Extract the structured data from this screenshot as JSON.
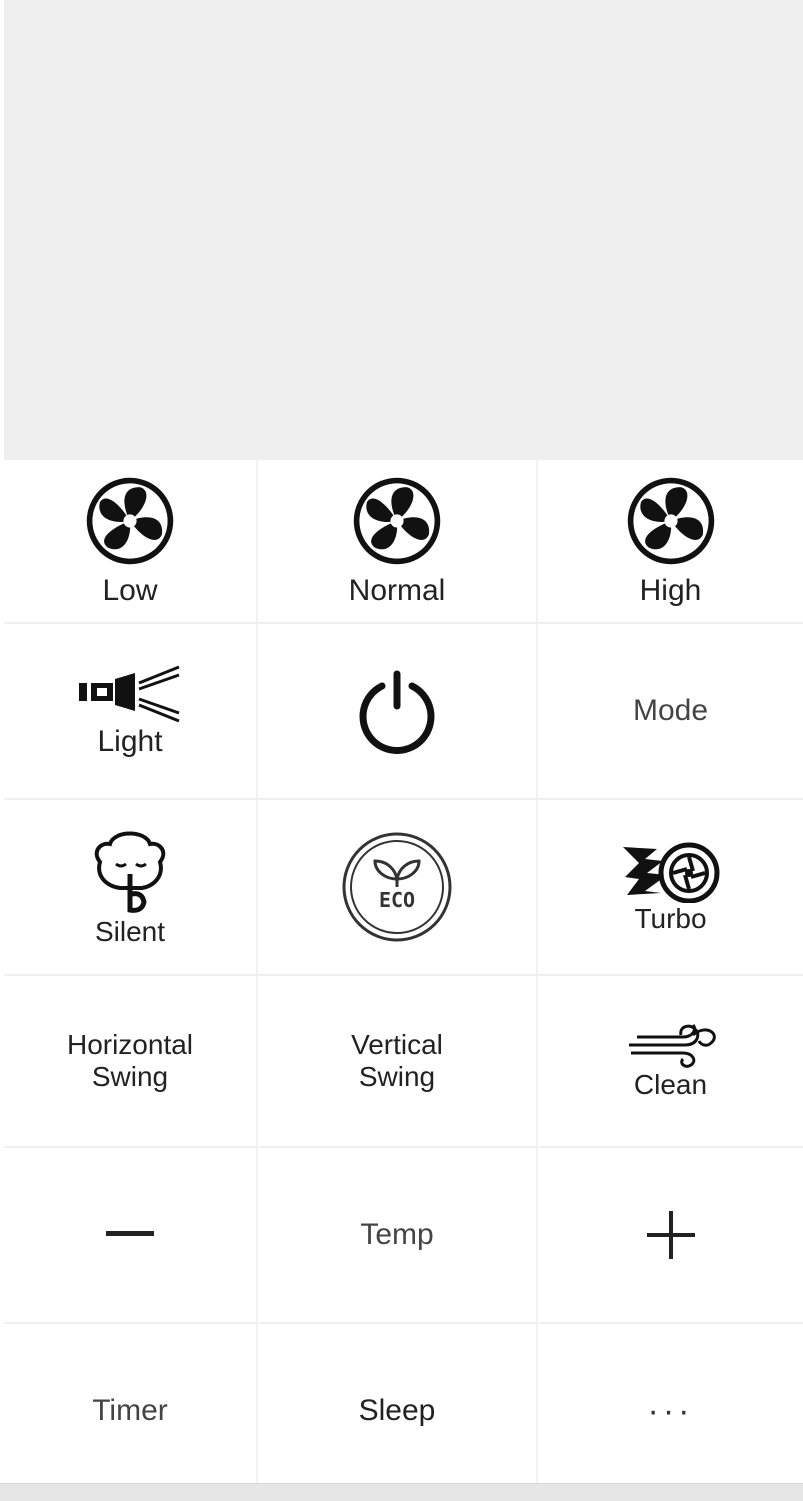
{
  "fan": {
    "low_label": "Low",
    "normal_label": "Normal",
    "high_label": "High"
  },
  "row2": {
    "light_label": "Light",
    "power_icon": "power-icon",
    "mode_label": "Mode"
  },
  "row3": {
    "silent_label": "Silent",
    "eco_label": "ECO",
    "turbo_label": "Turbo"
  },
  "row4": {
    "horizontal_line1": "Horizontal",
    "horizontal_line2": "Swing",
    "vertical_line1": "Vertical",
    "vertical_line2": "Swing",
    "clean_label": "Clean"
  },
  "temp": {
    "minus_icon": "minus-icon",
    "label": "Temp",
    "plus_icon": "plus-icon"
  },
  "row6": {
    "timer_label": "Timer",
    "sleep_label": "Sleep",
    "more_label": "···"
  },
  "colors": {
    "icon": "#111111",
    "top_area": "#efefef"
  }
}
